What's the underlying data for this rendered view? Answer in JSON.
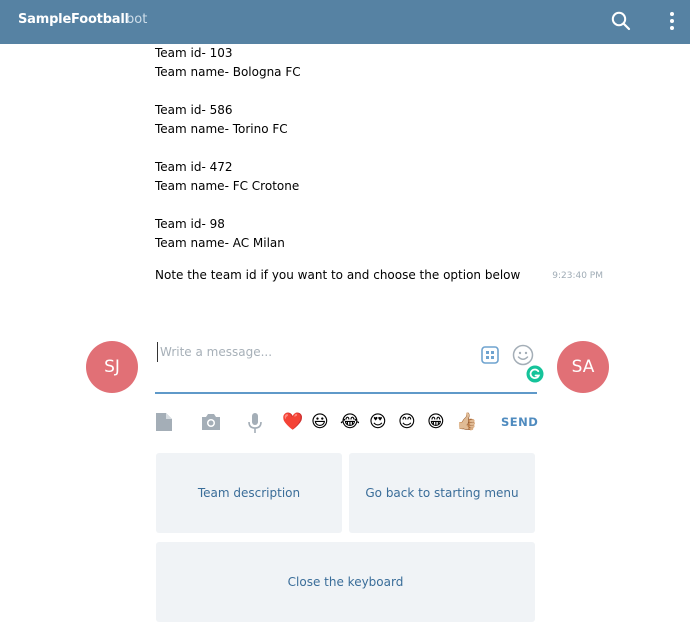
{
  "header": {
    "title": "SampleFootball",
    "subtitle": "bot",
    "search_icon": "search-icon",
    "menu_icon": "kebab-menu-icon"
  },
  "teams": [
    {
      "id": "Team id- 103",
      "name": "Team name- Bologna FC"
    },
    {
      "id": "Team id- 586",
      "name": "Team name- Torino FC"
    },
    {
      "id": "Team id- 472",
      "name": "Team name- FC Crotone"
    },
    {
      "id": "Team id- 98",
      "name": "Team name- AC Milan"
    }
  ],
  "note": {
    "text": "Note the team id if you want to and choose the option below",
    "time": "9:23:40 PM"
  },
  "avatars": {
    "left": "SJ",
    "right": "SA",
    "color": "#e17076"
  },
  "composer": {
    "placeholder": "Write a message...",
    "value": ""
  },
  "toolbar": {
    "emojis": [
      "❤️",
      "😃",
      "😂",
      "😍",
      "😊",
      "😁",
      "👍🏼"
    ],
    "send_label": "SEND"
  },
  "keyboard": {
    "buttons": [
      "Team description",
      "Go back to starting menu",
      "Close the keyboard"
    ]
  },
  "colors": {
    "header": "#5682a3",
    "accent": "#4f8bbf",
    "button_bg": "#f0f3f6"
  }
}
